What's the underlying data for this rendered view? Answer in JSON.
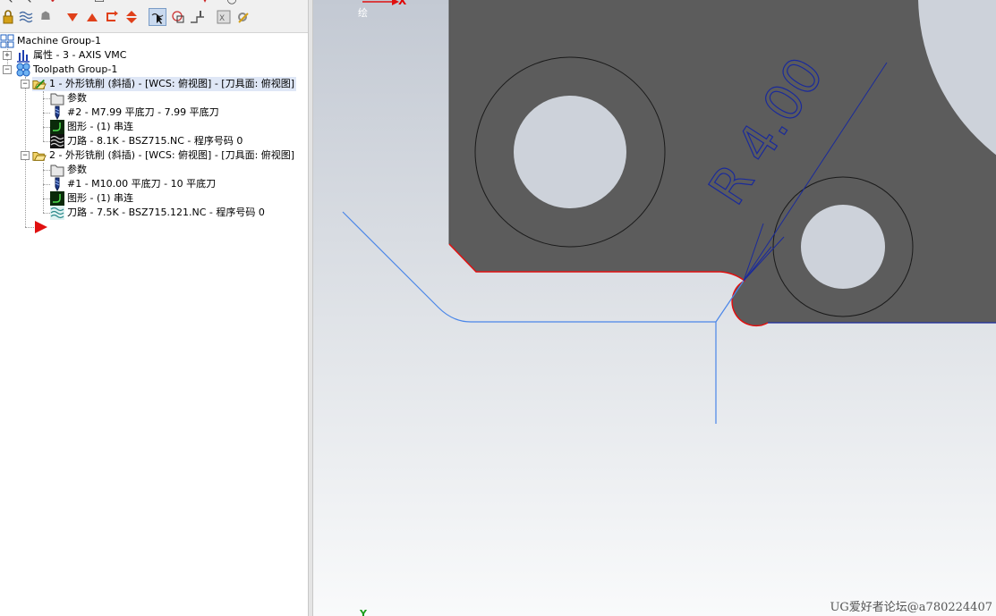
{
  "tree": {
    "machine_group": "Machine Group-1",
    "properties": "属性 - 3 - AXIS VMC",
    "toolpath_group": "Toolpath Group-1",
    "op1": {
      "title": "1 - 外形铣削 (斜插) - [WCS: 俯视图] - [刀具面: 俯视图]",
      "params": "参数",
      "tool": "#2 - M7.99 平底刀 - 7.99 平底刀",
      "geometry": "图形 - (1) 串连",
      "toolpath": "刀路 - 8.1K - BSZ715.NC - 程序号码 0"
    },
    "op2": {
      "title": "2 - 外形铣削 (斜插) - [WCS: 俯视图] - [刀具面: 俯视图]",
      "params": "参数",
      "tool": "#1 - M10.00 平底刀 - 10 平底刀",
      "geometry": "图形 - (1) 串连",
      "toolpath": "刀路 - 7.5K - BSZ715.121.NC - 程序号码 0"
    }
  },
  "viewport": {
    "dimension_label": "R 4.00",
    "axis_x": "X",
    "axis_y": "Y",
    "axis_draw": "绘",
    "watermark": "UG爱好者论坛@a780224407"
  },
  "colors": {
    "part_fill": "#5c5c5c",
    "toolpath": "#4a86e8",
    "selected_chain": "#e01010",
    "dimension": "#1a2a9a",
    "hole_fill": "#cdd2da"
  }
}
